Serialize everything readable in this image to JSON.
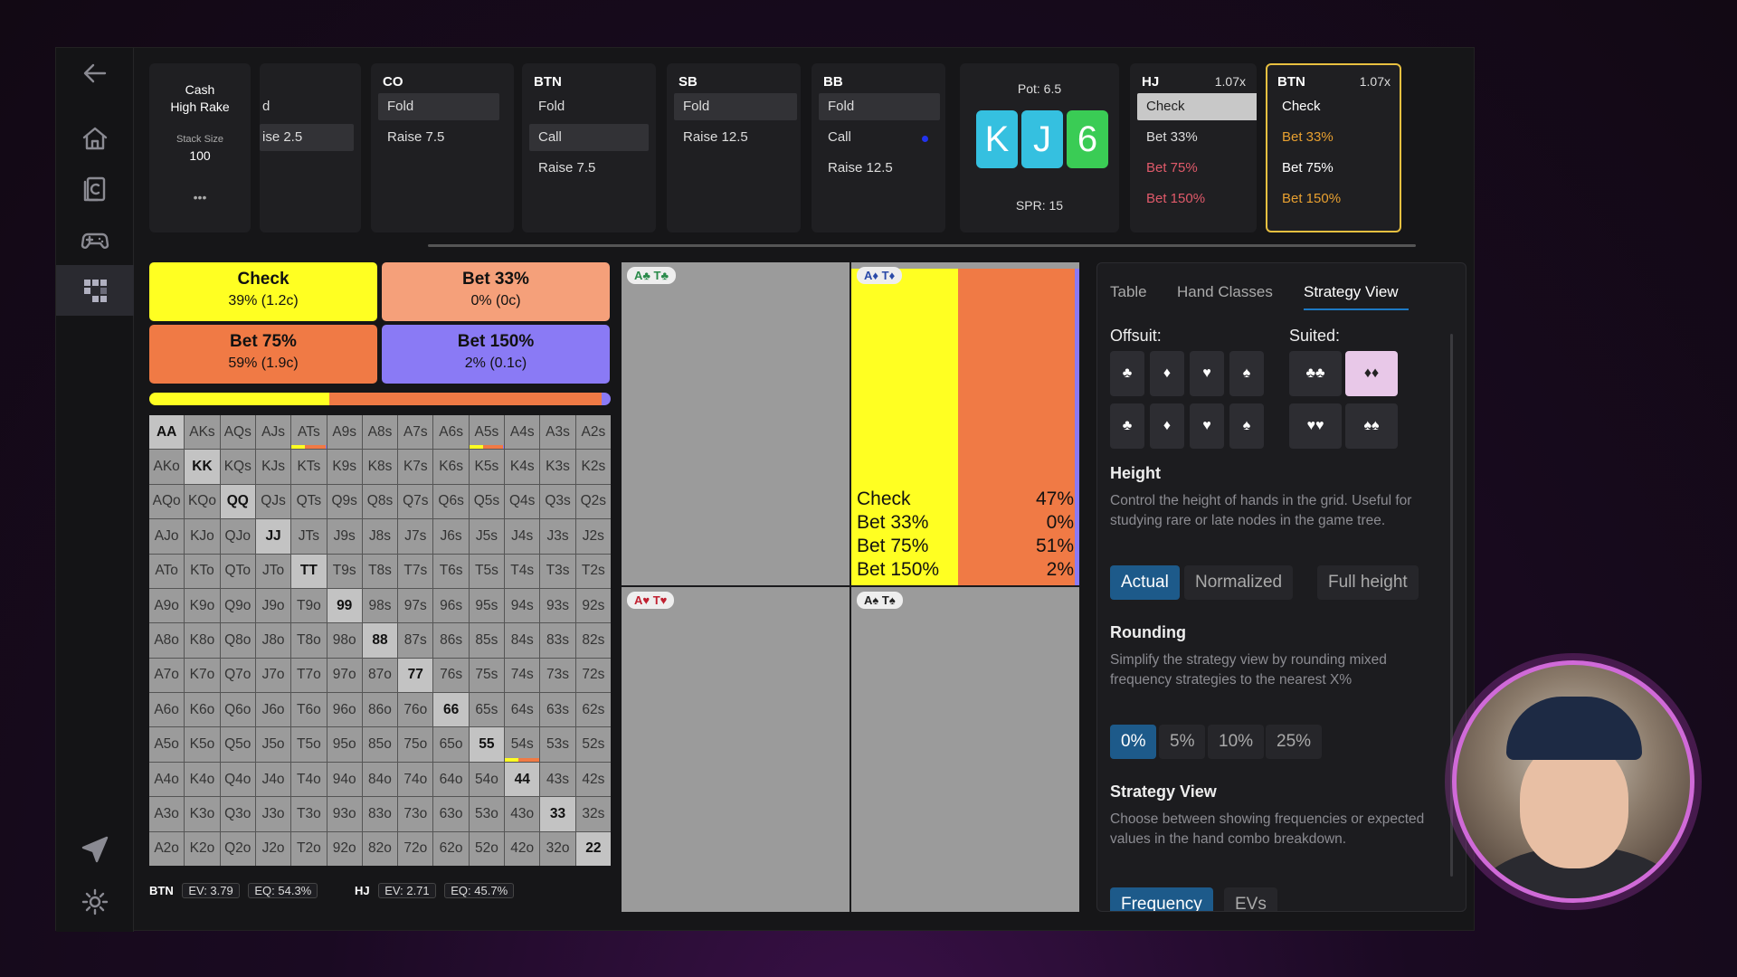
{
  "positions": {
    "settings": {
      "game": "Cash",
      "rake": "High Rake",
      "stack_label": "Stack Size",
      "stack_value": "100",
      "more": "•••"
    },
    "partial": {
      "fold": "d",
      "raise": "ise 2.5"
    },
    "co": {
      "name": "CO",
      "fold": "Fold",
      "raise": "Raise 7.5"
    },
    "btn": {
      "name": "BTN",
      "fold": "Fold",
      "call": "Call",
      "raise": "Raise 7.5"
    },
    "sb": {
      "name": "SB",
      "fold": "Fold",
      "raise": "Raise 12.5"
    },
    "bb": {
      "name": "BB",
      "fold": "Fold",
      "call": "Call",
      "raise": "Raise 12.5"
    },
    "board": {
      "pot": "Pot: 6.5",
      "cards": [
        "K",
        "J",
        "6"
      ],
      "spr": "SPR: 15"
    },
    "hj": {
      "name": "HJ",
      "mult": "1.07x",
      "a1": "Check",
      "a2": "Bet 33%",
      "a3": "Bet 75%",
      "a4": "Bet 150%"
    },
    "btn2": {
      "name": "BTN",
      "mult": "1.07x",
      "a1": "Check",
      "a2": "Bet 33%",
      "a3": "Bet 75%",
      "a4": "Bet 150%"
    }
  },
  "strategy": {
    "check": {
      "label": "Check",
      "sub": "39% (1.2c)"
    },
    "bet33": {
      "label": "Bet 33%",
      "sub": "0% (0c)"
    },
    "bet75": {
      "label": "Bet 75%",
      "sub": "59% (1.9c)"
    },
    "bet150": {
      "label": "Bet 150%",
      "sub": "2% (0.1c)"
    },
    "freq": [
      39,
      0,
      59,
      2
    ]
  },
  "grid": [
    [
      "AA",
      "AKs",
      "AQs",
      "AJs",
      "ATs",
      "A9s",
      "A8s",
      "A7s",
      "A6s",
      "A5s",
      "A4s",
      "A3s",
      "A2s"
    ],
    [
      "AKo",
      "KK",
      "KQs",
      "KJs",
      "KTs",
      "K9s",
      "K8s",
      "K7s",
      "K6s",
      "K5s",
      "K4s",
      "K3s",
      "K2s"
    ],
    [
      "AQo",
      "KQo",
      "QQ",
      "QJs",
      "QTs",
      "Q9s",
      "Q8s",
      "Q7s",
      "Q6s",
      "Q5s",
      "Q4s",
      "Q3s",
      "Q2s"
    ],
    [
      "AJo",
      "KJo",
      "QJo",
      "JJ",
      "JTs",
      "J9s",
      "J8s",
      "J7s",
      "J6s",
      "J5s",
      "J4s",
      "J3s",
      "J2s"
    ],
    [
      "ATo",
      "KTo",
      "QTo",
      "JTo",
      "TT",
      "T9s",
      "T8s",
      "T7s",
      "T6s",
      "T5s",
      "T4s",
      "T3s",
      "T2s"
    ],
    [
      "A9o",
      "K9o",
      "Q9o",
      "J9o",
      "T9o",
      "99",
      "98s",
      "97s",
      "96s",
      "95s",
      "94s",
      "93s",
      "92s"
    ],
    [
      "A8o",
      "K8o",
      "Q8o",
      "J8o",
      "T8o",
      "98o",
      "88",
      "87s",
      "86s",
      "85s",
      "84s",
      "83s",
      "82s"
    ],
    [
      "A7o",
      "K7o",
      "Q7o",
      "J7o",
      "T7o",
      "97o",
      "87o",
      "77",
      "76s",
      "75s",
      "74s",
      "73s",
      "72s"
    ],
    [
      "A6o",
      "K6o",
      "Q6o",
      "J6o",
      "T6o",
      "96o",
      "86o",
      "76o",
      "66",
      "65s",
      "64s",
      "63s",
      "62s"
    ],
    [
      "A5o",
      "K5o",
      "Q5o",
      "J5o",
      "T5o",
      "95o",
      "85o",
      "75o",
      "65o",
      "55",
      "54s",
      "53s",
      "52s"
    ],
    [
      "A4o",
      "K4o",
      "Q4o",
      "J4o",
      "T4o",
      "94o",
      "84o",
      "74o",
      "64o",
      "54o",
      "44",
      "43s",
      "42s"
    ],
    [
      "A3o",
      "K3o",
      "Q3o",
      "J3o",
      "T3o",
      "93o",
      "83o",
      "73o",
      "63o",
      "53o",
      "43o",
      "33",
      "32s"
    ],
    [
      "A2o",
      "K2o",
      "Q2o",
      "J2o",
      "T2o",
      "92o",
      "82o",
      "72o",
      "62o",
      "52o",
      "42o",
      "32o",
      "22"
    ]
  ],
  "stats": {
    "btn": {
      "name": "BTN",
      "ev": "EV: 3.79",
      "eq": "EQ: 54.3%"
    },
    "hj": {
      "name": "HJ",
      "ev": "EV: 2.71",
      "eq": "EQ: 45.7%"
    }
  },
  "combos": {
    "tl": {
      "label": "A♣ T♣",
      "color": "#2a8a4a"
    },
    "tr": {
      "label": "A♦ T♦",
      "color": "#2a4aa8",
      "mix": [
        47,
        0,
        51,
        2
      ],
      "legend": [
        {
          "name": "Check",
          "pct": "47%"
        },
        {
          "name": "Bet 33%",
          "pct": "0%"
        },
        {
          "name": "Bet 75%",
          "pct": "51%"
        },
        {
          "name": "Bet 150%",
          "pct": "2%"
        }
      ]
    },
    "bl": {
      "label": "A♥ T♥",
      "color": "#c02030"
    },
    "br": {
      "label": "A♠ T♠",
      "color": "#222"
    }
  },
  "panel": {
    "tabs": [
      "Table",
      "Hand Classes",
      "Strategy View"
    ],
    "offsuit_label": "Offsuit:",
    "suited_label": "Suited:",
    "offsuit": [
      "♣",
      "♦",
      "♥",
      "♠",
      "♣",
      "♦",
      "♥",
      "♠"
    ],
    "suited": [
      "♣♣",
      "♦♦",
      "♥♥",
      "♠♠"
    ],
    "height_title": "Height",
    "height_desc": "Control the height of hands in the grid. Useful for studying rare or late nodes in the game tree.",
    "height_opts": [
      "Actual",
      "Normalized",
      "Full height"
    ],
    "rounding_title": "Rounding",
    "rounding_desc": "Simplify the strategy view by rounding mixed frequency strategies to the nearest X%",
    "rounding_opts": [
      "0%",
      "5%",
      "10%",
      "25%"
    ],
    "sv_title": "Strategy View",
    "sv_desc": "Choose between showing frequencies or expected values in the hand combo breakdown.",
    "sv_opts": [
      "Frequency",
      "EVs"
    ]
  },
  "colors": {
    "check": "#ffff22",
    "bet33": "#f5a07a",
    "bet75": "#f07a45",
    "bet150": "#8a7af5",
    "accent": "#1d5a8a",
    "highlight": "#e8c040",
    "cardK": "#35c0e0",
    "card6": "#3acc55"
  }
}
